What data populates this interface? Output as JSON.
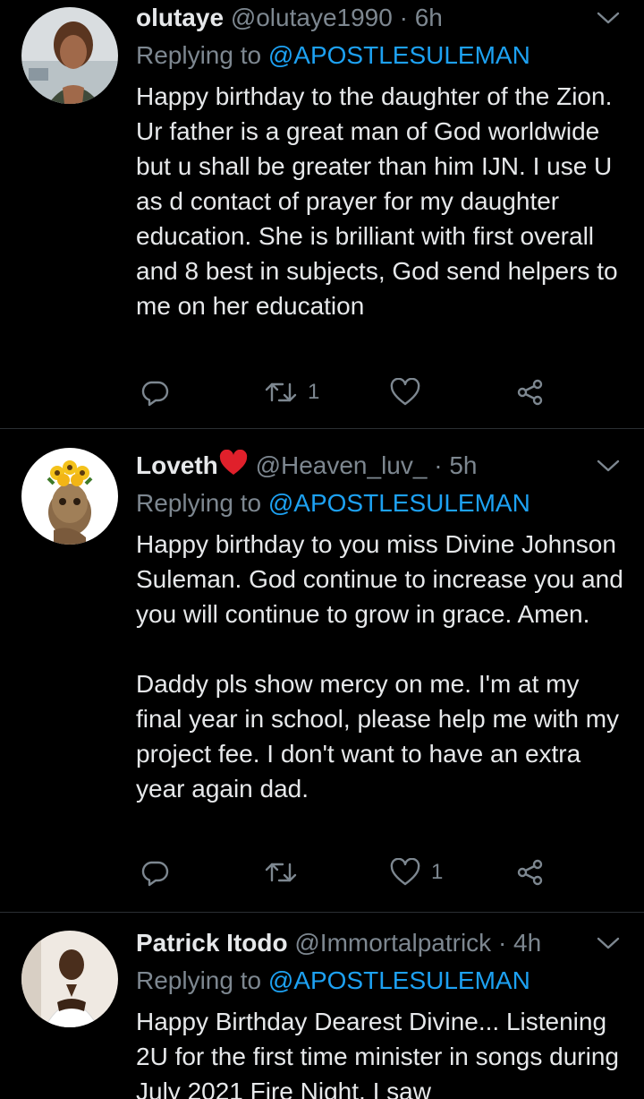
{
  "tweets": [
    {
      "name": "olutaye",
      "handle": "@olutaye1990",
      "time": "· 6h",
      "reply_prefix": "Replying to",
      "mention": "@APOSTLESULEMAN",
      "body": [
        "Happy birthday to the daughter of the Zion. Ur father is a great man of God worldwide but u shall be greater than him IJN. I use U as d contact of prayer for my daughter education. She is brilliant with first overall and 8 best in subjects, God send helpers to me on her education"
      ],
      "retweets": "1",
      "likes": ""
    },
    {
      "name": "Loveth",
      "handle": "@Heaven_luv_",
      "time": "· 5h",
      "reply_prefix": "Replying to",
      "mention": "@APOSTLESULEMAN",
      "body": [
        "Happy birthday to you miss Divine Johnson Suleman. God continue to increase you and you will continue to grow in grace. Amen.",
        "Daddy pls show mercy on me. I'm at my final year in school, please help me with my project fee. I don't want to have an extra year again dad."
      ],
      "retweets": "",
      "likes": "1"
    },
    {
      "name": "Patrick Itodo",
      "handle": "@Immortalpatrick",
      "time": "· 4h",
      "reply_prefix": "Replying to",
      "mention": "@APOSTLESULEMAN",
      "body": [
        "Happy Birthday Dearest Divine... Listening 2U for the first time minister in songs during July 2021 Fire Night, I saw"
      ],
      "retweets": "",
      "likes": ""
    }
  ],
  "icons": {
    "reply": "reply-icon",
    "retweet": "retweet-icon",
    "like": "heart-icon",
    "share": "share-icon",
    "more": "chevron-down-icon",
    "name_emoji": "red-heart-emoji"
  },
  "colors": {
    "background": "#000000",
    "text": "#e6e8ea",
    "muted": "#7d8790",
    "mention": "#1da1f2",
    "separator": "#2b2f33",
    "emoji_heart": "#e0202b"
  }
}
